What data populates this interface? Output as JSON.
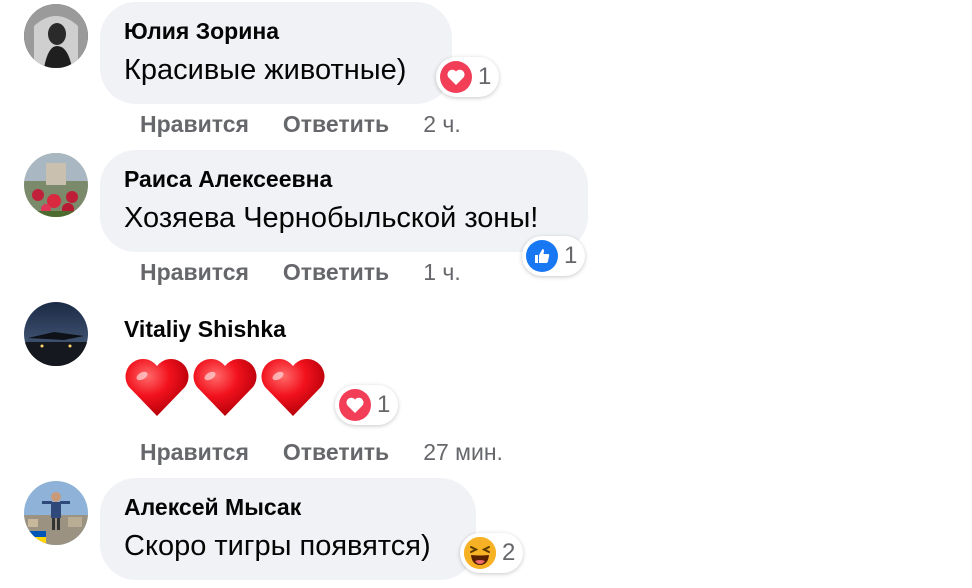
{
  "comments": [
    {
      "author": "Юлия Зорина",
      "text": "Красивые животные)",
      "reaction": {
        "icon": "heart-reaction-icon",
        "color": "#f33e58",
        "count": "1"
      },
      "like_label": "Нравится",
      "reply_label": "Ответить",
      "time": "2 ч."
    },
    {
      "author": "Раиса Алексеевна",
      "text": "Хозяева Чернобыльской зоны!",
      "reaction": {
        "icon": "like-reaction-icon",
        "color": "#1877f2",
        "count": "1"
      },
      "like_label": "Нравится",
      "reply_label": "Ответить",
      "time": "1 ч."
    },
    {
      "author": "Vitaliy Shishka",
      "text_icon": "three-red-hearts-emoji",
      "reaction": {
        "icon": "heart-reaction-icon",
        "color": "#f33e58",
        "count": "1"
      },
      "like_label": "Нравится",
      "reply_label": "Ответить",
      "time": "27 мин."
    },
    {
      "author": "Алексей Мысак",
      "text": "Скоро тигры появятся)",
      "reaction": {
        "icon": "haha-reaction-icon",
        "color": "#f7b125",
        "count": "2"
      }
    }
  ]
}
